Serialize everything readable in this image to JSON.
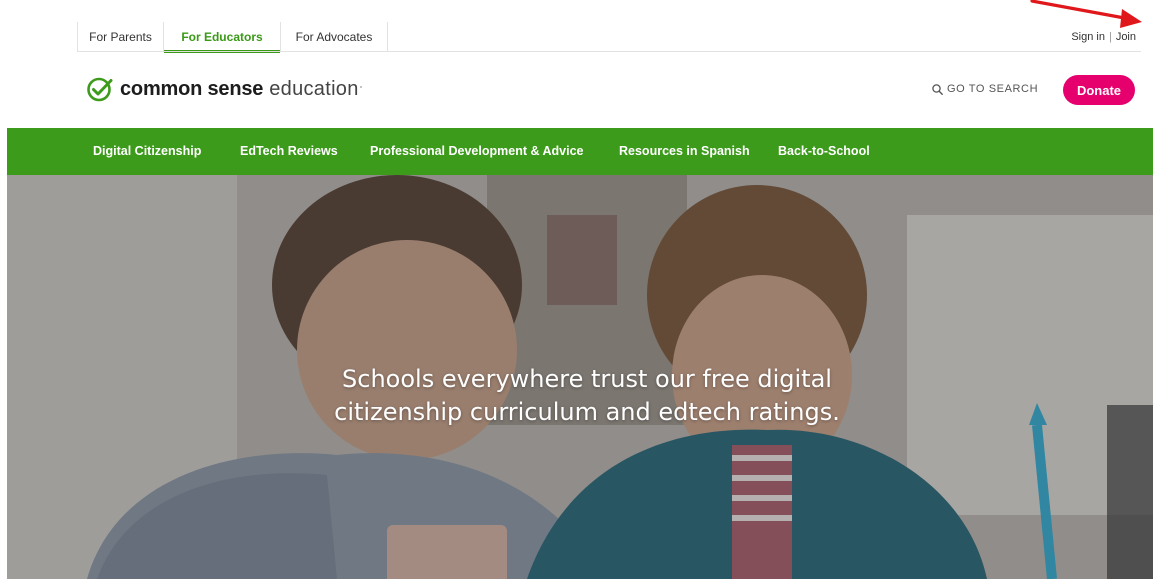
{
  "audience_tabs": [
    {
      "label": "For Parents",
      "active": false
    },
    {
      "label": "For Educators",
      "active": true
    },
    {
      "label": "For Advocates",
      "active": false
    }
  ],
  "account": {
    "sign_in": "Sign in",
    "divider": "|",
    "join": "Join"
  },
  "brand": {
    "name_bold": "common sense",
    "name_light": "education",
    "trademark": "°"
  },
  "search": {
    "label": "GO TO SEARCH",
    "icon": "search-icon"
  },
  "donate": {
    "label": "Donate"
  },
  "main_nav": [
    {
      "label": "Digital Citizenship"
    },
    {
      "label": "EdTech Reviews"
    },
    {
      "label": "Professional Development & Advice"
    },
    {
      "label": "Resources in Spanish"
    },
    {
      "label": "Back-to-School"
    }
  ],
  "hero": {
    "headline_line1": "Schools everywhere trust our free digital",
    "headline_line2": "citizenship curriculum and edtech ratings."
  },
  "colors": {
    "brand_green": "#3d9b1c",
    "active_tab_green": "#3a9a18",
    "donate_pink": "#e5006e",
    "annotation_red": "#e0181b"
  }
}
